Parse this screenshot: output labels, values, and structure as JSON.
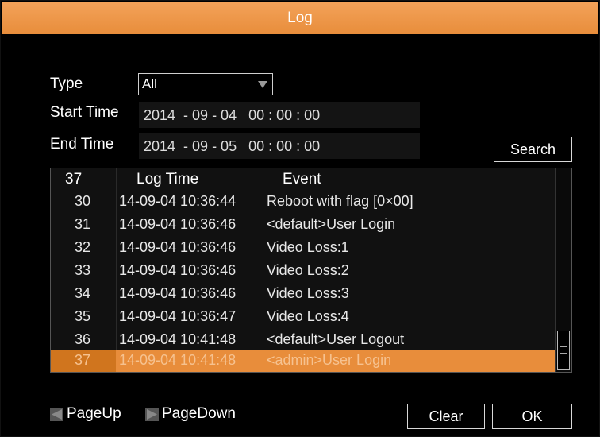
{
  "window": {
    "title": "Log"
  },
  "filters": {
    "type_label": "Type",
    "type_value": "All",
    "start_label": "Start Time",
    "start_value": "2014  - 09 - 04   00 : 00 : 00",
    "end_label": "End Time",
    "end_value": "2014  - 09 - 05   00 : 00 : 00",
    "search_label": "Search"
  },
  "list": {
    "header": {
      "count": "37",
      "time": "Log Time",
      "event": "Event"
    },
    "rows": [
      {
        "num": "30",
        "time": "14-09-04 10:36:44",
        "event": "Reboot with flag [0×00]"
      },
      {
        "num": "31",
        "time": "14-09-04 10:36:46",
        "event": "<default>User Login"
      },
      {
        "num": "32",
        "time": "14-09-04 10:36:46",
        "event": "Video Loss:1"
      },
      {
        "num": "33",
        "time": "14-09-04 10:36:46",
        "event": "Video Loss:2"
      },
      {
        "num": "34",
        "time": "14-09-04 10:36:46",
        "event": "Video Loss:3"
      },
      {
        "num": "35",
        "time": "14-09-04 10:36:47",
        "event": "Video Loss:4"
      },
      {
        "num": "36",
        "time": "14-09-04 10:41:48",
        "event": "<default>User Logout"
      },
      {
        "num": "37",
        "time": "14-09-04 10:41:48",
        "event": "<admin>User Login"
      }
    ]
  },
  "footer": {
    "pageup_label": "PageUp",
    "pagedown_label": "PageDown",
    "clear_label": "Clear",
    "ok_label": "OK"
  },
  "colors": {
    "accent": "#e88d3b",
    "background": "#000000"
  },
  "icons": {
    "pageup": "pageup-icon",
    "pagedown": "pagedown-icon",
    "dropdown": "chevron-down-icon"
  }
}
